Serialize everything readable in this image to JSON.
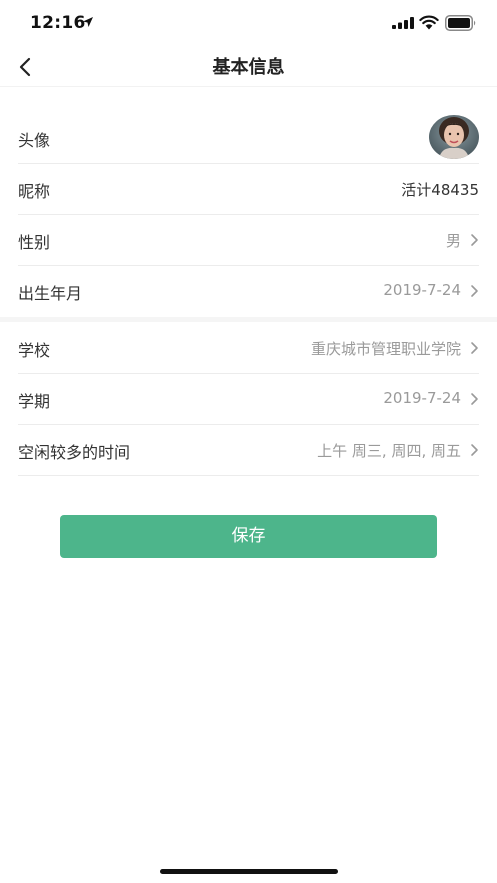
{
  "status_bar": {
    "time": "12:16"
  },
  "header": {
    "title": "基本信息"
  },
  "profile": {
    "avatar_label": "头像",
    "nickname_label": "昵称",
    "nickname_value": "活计48435",
    "gender_label": "性别",
    "gender_value": "男",
    "birth_label": "出生年月",
    "birth_value": "2019-7-24"
  },
  "education": {
    "school_label": "学校",
    "school_value": "重庆城市管理职业学院",
    "term_label": "学期",
    "term_value": "2019-7-24",
    "free_time_label": "空闲较多的时间",
    "free_time_value": "上午 周三, 周四, 周五"
  },
  "actions": {
    "save_label": "保存"
  },
  "colors": {
    "accent": "#4db58b",
    "muted_text": "#9a9a9a"
  }
}
